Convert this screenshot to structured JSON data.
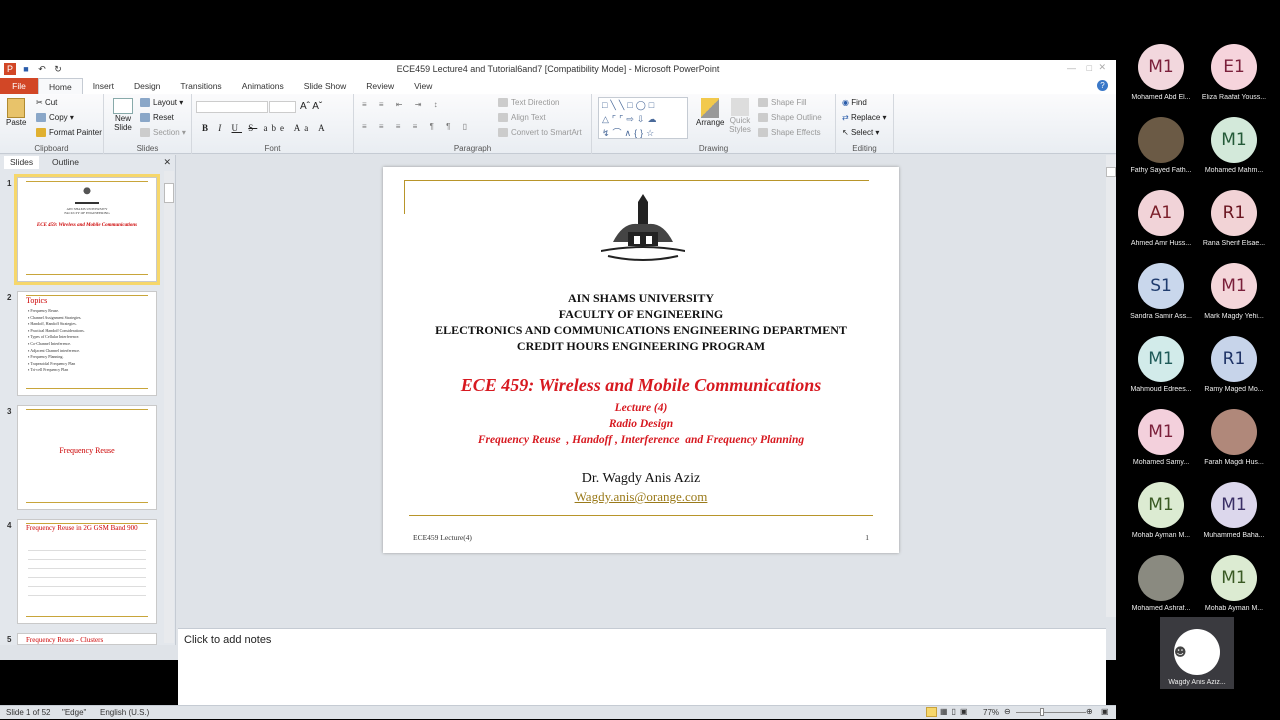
{
  "window": {
    "title": "ECE459 Lecture4 and Tutorial6and7 [Compatibility Mode] - Microsoft PowerPoint"
  },
  "tabs": [
    "File",
    "Home",
    "Insert",
    "Design",
    "Transitions",
    "Animations",
    "Slide Show",
    "Review",
    "View"
  ],
  "ribbon": {
    "clipboard": {
      "label": "Clipboard",
      "paste": "Paste",
      "cut": "Cut",
      "copy": "Copy",
      "format_painter": "Format Painter"
    },
    "slides": {
      "label": "Slides",
      "new_slide": "New Slide",
      "layout": "Layout",
      "reset": "Reset",
      "section": "Section"
    },
    "font": {
      "label": "Font",
      "bold": "B",
      "italic": "I",
      "underline": "U",
      "strike": "S",
      "abc": "abe",
      "aa": "Aa",
      "a": "A"
    },
    "paragraph": {
      "label": "Paragraph",
      "text_direction": "Text Direction",
      "align_text": "Align Text",
      "smartart": "Convert to SmartArt"
    },
    "drawing": {
      "label": "Drawing",
      "arrange": "Arrange",
      "quick_styles": "Quick Styles",
      "shape_fill": "Shape Fill",
      "shape_outline": "Shape Outline",
      "shape_effects": "Shape Effects"
    },
    "editing": {
      "label": "Editing",
      "find": "Find",
      "replace": "Replace",
      "select": "Select"
    }
  },
  "panel": {
    "tabs": [
      "Slides",
      "Outline"
    ],
    "thumbs": [
      {
        "num": "1",
        "title": "ECE 459: Wireless and Mobile Communications"
      },
      {
        "num": "2",
        "title": "Topics",
        "items": [
          "Frequency Reuse.",
          "Channel Assignment Strategies.",
          "Handoff, Handoff Strategies.",
          "Practical Handoff Considerations.",
          "Types of Cellular Interference.",
          "Co-Channel Interference.",
          "Adjacent Channel interference.",
          "Frequency Planning.",
          "Trapezoidal Frequency Plan",
          "Tri-cell Frequency Plan"
        ]
      },
      {
        "num": "3",
        "title": "Frequency Reuse"
      },
      {
        "num": "4",
        "title": "Frequency Reuse in 2G GSM Band 900"
      },
      {
        "num": "5",
        "title": "Frequency Reuse - Clusters"
      }
    ]
  },
  "slide": {
    "uni": [
      "AIN SHAMS UNIVERSITY",
      "FACULTY OF ENGINEERING",
      "ELECTRONICS AND COMMUNICATIONS ENGINEERING DEPARTMENT",
      "CREDIT  HOURS  ENGINEERING  PROGRAM"
    ],
    "course": "ECE 459: Wireless and Mobile Communications",
    "lecture": "Lecture (4)",
    "topic": "Radio Design",
    "subtitle": "Frequency Reuse  , Handoff , Interference  and Frequency Planning",
    "author": "Dr. Wagdy Anis Aziz",
    "email": "Wagdy.anis@orange.com",
    "footer": "ECE459 Lecture(4)",
    "page": "1"
  },
  "notes": {
    "placeholder": "Click to add notes"
  },
  "status": {
    "slide": "Slide 1 of 52",
    "theme": "\"Edge\"",
    "lang": "English (U.S.)",
    "zoom": "77%"
  },
  "participants": [
    {
      "initials": "M1",
      "name": "Mohamed Abd El...",
      "color": "#f2d7dd",
      "fg": "#7a1f3a"
    },
    {
      "initials": "E1",
      "name": "Eliza Raafat Youss...",
      "color": "#f6d4dc",
      "fg": "#7a1f3a"
    },
    {
      "initials": "",
      "name": "Fathy Sayed Fath...",
      "color": "#6b5a45",
      "fg": "#fff"
    },
    {
      "initials": "M1",
      "name": "Mohamed Mahm...",
      "color": "#d3e9da",
      "fg": "#245a38"
    },
    {
      "initials": "A1",
      "name": "Ahmed Amr Huss...",
      "color": "#f1d3d8",
      "fg": "#7a1f2a"
    },
    {
      "initials": "R1",
      "name": "Rana Sherif Elsae...",
      "color": "#f2d3d6",
      "fg": "#6a1520"
    },
    {
      "initials": "S1",
      "name": "Sandra Samir Ass...",
      "color": "#c9d7ec",
      "fg": "#1f3c6e"
    },
    {
      "initials": "M1",
      "name": "Mark Magdy Yehi...",
      "color": "#f4d6da",
      "fg": "#7a1f3a"
    },
    {
      "initials": "M1",
      "name": "Mahmoud Edrees...",
      "color": "#d2ebea",
      "fg": "#1f5a58"
    },
    {
      "initials": "R1",
      "name": "Ramy Maged Mo...",
      "color": "#c7d4ea",
      "fg": "#1f3366"
    },
    {
      "initials": "M1",
      "name": "Mohamed Samy...",
      "color": "#f3d0dc",
      "fg": "#7a1f3a"
    },
    {
      "initials": "",
      "name": "Farah Magdi Hus...",
      "color": "#b0887a",
      "fg": "#fff"
    },
    {
      "initials": "M1",
      "name": "Mohab Ayman M...",
      "color": "#dcebd2",
      "fg": "#3a5a24"
    },
    {
      "initials": "M1",
      "name": "Muhammed Baha...",
      "color": "#dcd7ec",
      "fg": "#3a2f66"
    },
    {
      "initials": "",
      "name": "Mohamed Ashraf...",
      "color": "#8a8a80",
      "fg": "#fff"
    },
    {
      "initials": "M1",
      "name": "Mohab Ayman M...",
      "color": "#dcebd2",
      "fg": "#3a5a24"
    }
  ],
  "presenter": {
    "name": "Wagdy Anis Aziz..."
  }
}
